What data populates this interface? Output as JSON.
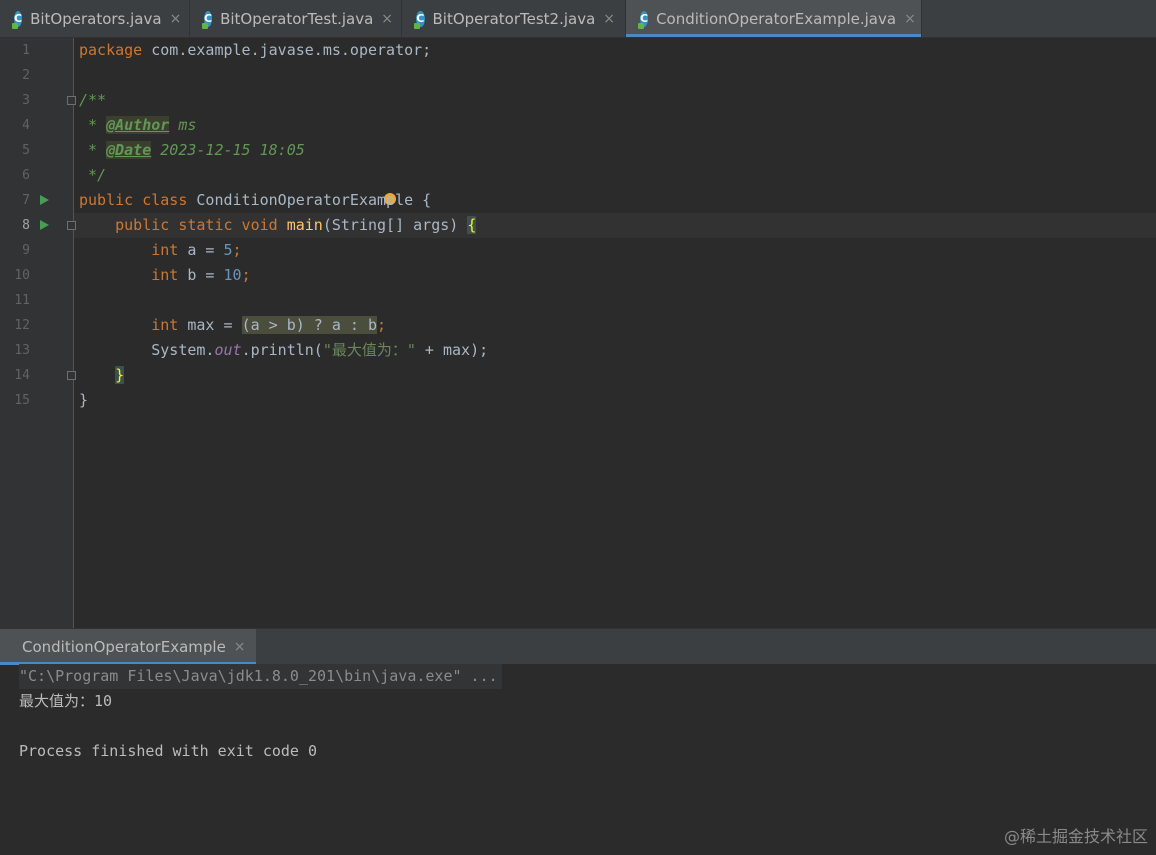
{
  "tabs": [
    {
      "label": "BitOperators.java",
      "close": "×",
      "icon": "java-class-icon"
    },
    {
      "label": "BitOperatorTest.java",
      "close": "×",
      "icon": "java-class-icon"
    },
    {
      "label": "BitOperatorTest2.java",
      "close": "×",
      "icon": "java-class-icon"
    },
    {
      "label": "ConditionOperatorExample.java",
      "close": "×",
      "icon": "java-class-icon",
      "active": true
    }
  ],
  "line_numbers": [
    "1",
    "2",
    "3",
    "4",
    "5",
    "6",
    "7",
    "8",
    "9",
    "10",
    "11",
    "12",
    "13",
    "14",
    "15"
  ],
  "code": {
    "l1_kw": "package",
    "l1_rest": " com.example.javase.ms.operator;",
    "l3": "/**",
    "l4_star": " * ",
    "l4_tag": "@Author",
    "l4_val": " ms",
    "l5_star": " * ",
    "l5_tag": "@Date",
    "l5_val": " 2023-12-15 18:05",
    "l6": " */",
    "l7_kw": "public class",
    "l7_name": " ConditionOperatorExample {",
    "l8_indent": "    ",
    "l8_kw": "public static void",
    "l8_sp": " ",
    "l8_fn": "main",
    "l8_args": "(String[] args) ",
    "l8_brace": "{",
    "l9_indent": "        ",
    "l9_kw": "int",
    "l9_mid": " a = ",
    "l9_num": "5",
    "l9_semi": ";",
    "l10_indent": "        ",
    "l10_kw": "int",
    "l10_mid": " b = ",
    "l10_num": "10",
    "l10_semi": ";",
    "l12_indent": "        ",
    "l12_kw": "int",
    "l12_mid": " max = ",
    "l12_expr": "(a > b) ? a : b",
    "l12_semi": ";",
    "l13_indent": "        ",
    "l13_sys": "System.",
    "l13_out": "out",
    "l13_call": ".println(",
    "l13_str": "\"最大值为：\"",
    "l13_rest": " + max);",
    "l14_indent": "    ",
    "l14_brace": "}",
    "l15": "}"
  },
  "run_panel": {
    "tab_label": "ConditionOperatorExample",
    "tab_close": "×",
    "command": "\"C:\\Program Files\\Java\\jdk1.8.0_201\\bin\\java.exe\" ...",
    "output": "最大值为：10",
    "exit": "Process finished with exit code 0"
  },
  "watermark": "@稀土掘金技术社区",
  "colors": {
    "background": "#2b2b2b",
    "keyword": "#cc7832",
    "number": "#6897bb",
    "string": "#6a8759",
    "doc_comment": "#629755",
    "accent": "#4a88c7"
  }
}
